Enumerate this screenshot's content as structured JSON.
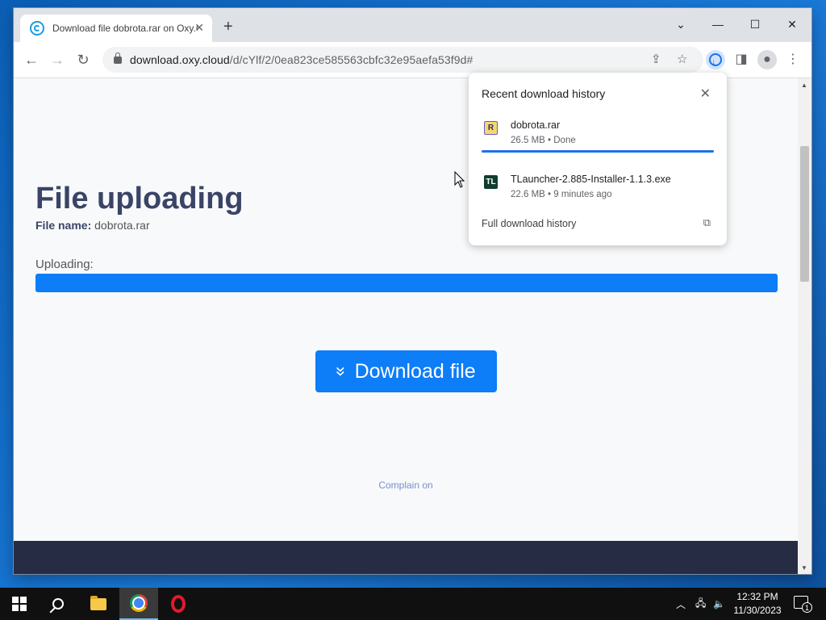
{
  "browser": {
    "tab_title": "Download file dobrota.rar on Oxy.Cloud",
    "tab_close": "✕",
    "new_tab": "+",
    "window_controls": {
      "minimize": "—",
      "maximize": "☐",
      "close": "✕",
      "menu": "⌄"
    },
    "url_host": "download.oxy.cloud",
    "url_path": "/d/cYlf/2/0ea823ce585563cbfc32e95aefa53f9d#"
  },
  "page": {
    "heading": "File uploading",
    "file_name_label": "File name:",
    "file_name_value": "dobrota.rar",
    "uploading_label": "Uploading:",
    "progress_fraction": 1.0,
    "download_button": "Download file",
    "complain_link": "Complain on"
  },
  "download_popup": {
    "title": "Recent download history",
    "items": [
      {
        "name": "dobrota.rar",
        "meta": "26.5 MB • Done",
        "icon": "rar-file-icon",
        "icon_text": "R"
      },
      {
        "name": "TLauncher-2.885-Installer-1.1.3.exe",
        "meta": "22.6 MB • 9 minutes ago",
        "icon": "tlauncher-icon",
        "icon_text": "TL"
      }
    ],
    "full_history": "Full download history"
  },
  "taskbar": {
    "clock_time": "12:32 PM",
    "clock_date": "11/30/2023",
    "notification_count": "1"
  },
  "colors": {
    "accent": "#0d7df8",
    "heading": "#3a4466",
    "footer": "#272c45",
    "chrome_download": "#1a73e8"
  }
}
